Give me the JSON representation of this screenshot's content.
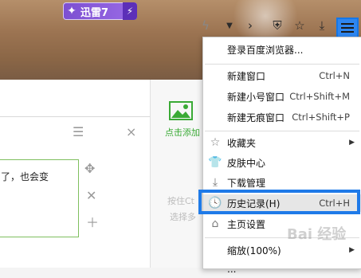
{
  "badge": {
    "text": "迅雷7"
  },
  "menu": {
    "login": "登录百度浏览器...",
    "new_window": {
      "label": "新建窗口",
      "shortcut": "Ctrl+N"
    },
    "new_small": {
      "label": "新建小号窗口",
      "shortcut": "Ctrl+Shift+M"
    },
    "new_incognito": {
      "label": "新建无痕窗口",
      "shortcut": "Ctrl+Shift+P"
    },
    "favorites": {
      "label": "收藏夹"
    },
    "skins": {
      "label": "皮肤中心"
    },
    "downloads": {
      "label": "下载管理"
    },
    "history": {
      "label": "历史记录(H)",
      "shortcut": "Ctrl+H"
    },
    "homepage": {
      "label": "主页设置"
    },
    "zoom": {
      "label": "缩放(100%)"
    },
    "more": {
      "label": "..."
    }
  },
  "content": {
    "text_fragment": "了，也会变",
    "add_label": "点击添加",
    "hint_line1": "按住Ct",
    "hint_line2": "选择多"
  },
  "colors": {
    "accent": "#1f7ae8",
    "badge": "#8a5ce0",
    "green": "#3aaa35"
  }
}
